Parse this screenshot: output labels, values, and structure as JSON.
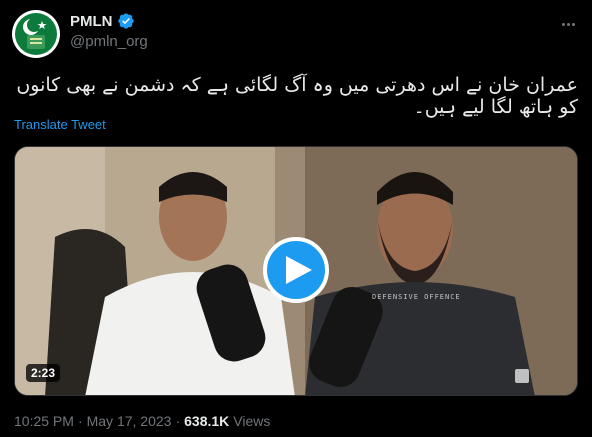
{
  "account": {
    "name": "PMLN",
    "handle": "@pmln_org",
    "avatar_icon": "pmln-logo-icon",
    "verified_icon": "verified-badge-icon",
    "more_icon": "more-options-icon"
  },
  "tweet": {
    "text": "عمران خان نے اس دھرتی میں وہ آگ لگائی ہے کہ دشمن نے بھی کانوں کو ہاتھ لگا لیے ہیں۔",
    "translate_label": "Translate Tweet"
  },
  "media": {
    "duration": "2:23",
    "play_icon": "play-icon",
    "watermark": "DEFENSIVE OFFENCE",
    "play_color": "#1d9bf0"
  },
  "meta": {
    "time": "10:25 PM",
    "separator": "·",
    "date": "May 17, 2023",
    "views_count": "638.1K",
    "views_label": "Views"
  }
}
